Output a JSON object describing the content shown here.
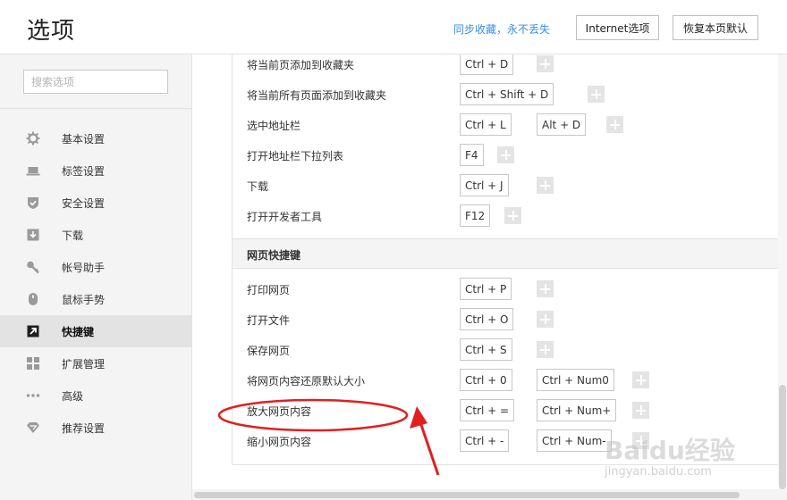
{
  "header": {
    "title": "选项",
    "sync_link": "同步收藏，永不丢失",
    "internet_button": "Internet选项",
    "restore_button": "恢复本页默认"
  },
  "sidebar": {
    "search_placeholder": "搜索选项",
    "items": [
      {
        "label": "基本设置",
        "icon": "gear-icon"
      },
      {
        "label": "标签设置",
        "icon": "laptop-icon"
      },
      {
        "label": "安全设置",
        "icon": "shield-icon"
      },
      {
        "label": "下载",
        "icon": "download-icon"
      },
      {
        "label": "帐号助手",
        "icon": "key-icon"
      },
      {
        "label": "鼠标手势",
        "icon": "mouse-icon"
      },
      {
        "label": "快捷键",
        "icon": "shortcut-arrow-icon",
        "active": true
      },
      {
        "label": "扩展管理",
        "icon": "grid-icon"
      },
      {
        "label": "高级",
        "icon": "more-dots-icon"
      },
      {
        "label": "推荐设置",
        "icon": "diamond-icon"
      }
    ]
  },
  "shortcuts_top": [
    {
      "label": "将当前页添加到收藏夹",
      "keys": [
        "Ctrl + D"
      ]
    },
    {
      "label": "将当前所有页面添加到收藏夹",
      "keys": [
        "Ctrl + Shift + D"
      ]
    },
    {
      "label": "选中地址栏",
      "keys": [
        "Ctrl + L",
        "Alt + D"
      ]
    },
    {
      "label": "打开地址栏下拉列表",
      "keys": [
        "F4"
      ]
    },
    {
      "label": "下载",
      "keys": [
        "Ctrl + J"
      ]
    },
    {
      "label": "打开开发者工具",
      "keys": [
        "F12"
      ]
    }
  ],
  "section_title": "网页快捷键",
  "shortcuts_page": [
    {
      "label": "打印网页",
      "keys": [
        "Ctrl + P"
      ]
    },
    {
      "label": "打开文件",
      "keys": [
        "Ctrl + O"
      ]
    },
    {
      "label": "保存网页",
      "keys": [
        "Ctrl + S"
      ]
    },
    {
      "label": "将网页内容还原默认大小",
      "keys": [
        "Ctrl + 0",
        "Ctrl + Num0"
      ]
    },
    {
      "label": "放大网页内容",
      "keys": [
        "Ctrl + =",
        "Ctrl + Num+"
      ]
    },
    {
      "label": "缩小网页内容",
      "keys": [
        "Ctrl + -",
        "Ctrl + Num-"
      ]
    }
  ],
  "watermark": {
    "text": "Baidu经验",
    "sub": "jingyan.baidu.com"
  },
  "colors": {
    "accent_link": "#3a8ee6",
    "annotation_red": "#e02020",
    "active_nav_bg": "#e3e3e3"
  }
}
